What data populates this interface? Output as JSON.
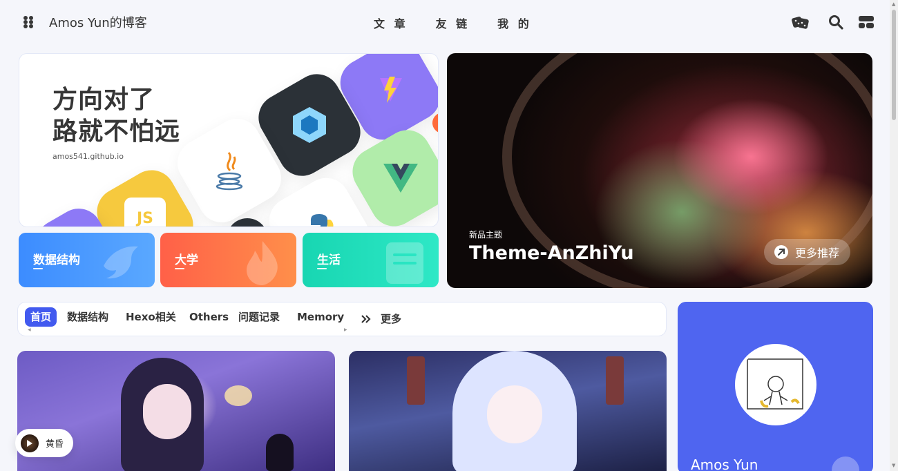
{
  "header": {
    "site_title": "Amos Yun的博客",
    "nav": [
      "文 章",
      "友 链",
      "我 的"
    ],
    "icons": [
      "menu-grid-icon",
      "dice-icon",
      "search-icon",
      "layout-icon"
    ]
  },
  "banner": {
    "title_line1": "方向对了",
    "title_line2": "路就不怕远",
    "url": "amos541.github.io",
    "tile_icons": [
      "vite-icon",
      "webpack-icon",
      "java-icon",
      "vue-icon",
      "js-icon",
      "python-icon"
    ]
  },
  "categories": [
    {
      "label": "数据结构",
      "color_from": "#3c8cff",
      "color_to": "#5aa8ff",
      "icon": "bird-icon"
    },
    {
      "label": "大学",
      "color_from": "#ff6048",
      "color_to": "#ff8f4a",
      "icon": "flame-icon"
    },
    {
      "label": "生活",
      "color_from": "#18d6b2",
      "color_to": "#2ee8c6",
      "icon": "note-icon"
    }
  ],
  "theme_card": {
    "subtitle": "新品主题",
    "title": "Theme-AnZhiYu",
    "button_label": "更多推荐"
  },
  "category_bar": {
    "items": [
      "首页",
      "数据结构",
      "Hexo相关",
      "Others",
      "问题记录",
      "Memory"
    ],
    "active_index": 0,
    "more_label": "更多"
  },
  "music": {
    "title": "黄昏"
  },
  "author": {
    "name": "Amos Yun"
  },
  "colors": {
    "accent": "#425aef",
    "author_card": "#4f65f0",
    "page_bg": "#f5f6fb"
  }
}
